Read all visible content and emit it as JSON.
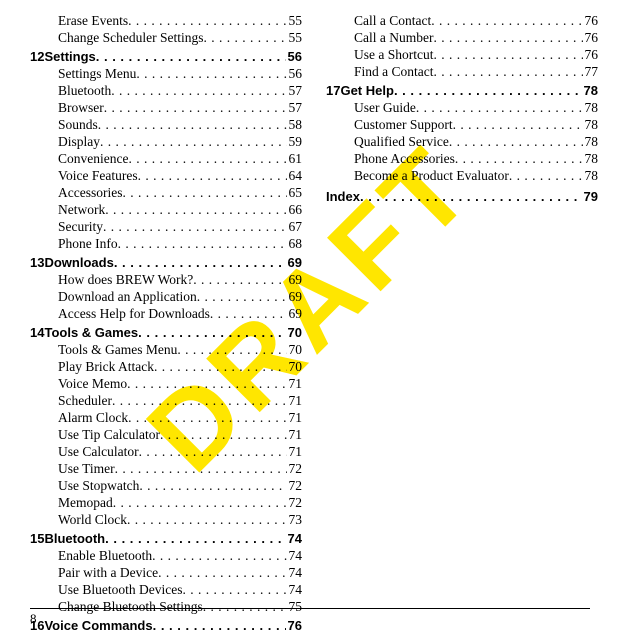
{
  "watermark": "DRAFT",
  "page_number": "8",
  "columns": [
    [
      {
        "type": "sub",
        "title": "Erase Events",
        "page": "55"
      },
      {
        "type": "sub",
        "title": "Change Scheduler Settings",
        "page": "55"
      },
      {
        "type": "chap",
        "num": "12",
        "title": "Settings",
        "page": "56"
      },
      {
        "type": "sub",
        "title": "Settings Menu",
        "page": "56"
      },
      {
        "type": "sub",
        "title": "Bluetooth",
        "page": "57"
      },
      {
        "type": "sub",
        "title": "Browser",
        "page": "57"
      },
      {
        "type": "sub",
        "title": "Sounds",
        "page": "58"
      },
      {
        "type": "sub",
        "title": "Display",
        "page": "59"
      },
      {
        "type": "sub",
        "title": "Convenience",
        "page": "61"
      },
      {
        "type": "sub",
        "title": "Voice Features",
        "page": "64"
      },
      {
        "type": "sub",
        "title": "Accessories",
        "page": "65"
      },
      {
        "type": "sub",
        "title": "Network",
        "page": "66"
      },
      {
        "type": "sub",
        "title": "Security",
        "page": "67"
      },
      {
        "type": "sub",
        "title": "Phone Info",
        "page": "68"
      },
      {
        "type": "chap",
        "num": "13",
        "title": "Downloads",
        "page": "69"
      },
      {
        "type": "sub",
        "title": "How does BREW Work?",
        "page": "69"
      },
      {
        "type": "sub",
        "title": "Download an Application",
        "page": "69"
      },
      {
        "type": "sub",
        "title": "Access Help for Downloads",
        "page": "69"
      },
      {
        "type": "chap",
        "num": "14",
        "title": "Tools & Games",
        "page": "70"
      },
      {
        "type": "sub",
        "title": "Tools & Games Menu",
        "page": "70"
      },
      {
        "type": "sub",
        "title": "Play Brick Attack",
        "page": "70"
      },
      {
        "type": "sub",
        "title": "Voice Memo",
        "page": "71"
      },
      {
        "type": "sub",
        "title": "Scheduler",
        "page": "71"
      },
      {
        "type": "sub",
        "title": "Alarm Clock",
        "page": "71"
      },
      {
        "type": "sub",
        "title": "Use Tip Calculator",
        "page": "71"
      },
      {
        "type": "sub",
        "title": "Use Calculator",
        "page": "71"
      },
      {
        "type": "sub",
        "title": "Use Timer",
        "page": "72"
      },
      {
        "type": "sub",
        "title": "Use Stopwatch",
        "page": "72"
      },
      {
        "type": "sub",
        "title": "Memopad",
        "page": "72"
      },
      {
        "type": "sub",
        "title": "World Clock",
        "page": "73"
      },
      {
        "type": "chap",
        "num": "15",
        "title": "Bluetooth",
        "page": "74"
      },
      {
        "type": "sub",
        "title": "Enable Bluetooth",
        "page": "74"
      },
      {
        "type": "sub",
        "title": "Pair with a Device",
        "page": "74"
      },
      {
        "type": "sub",
        "title": "Use Bluetooth Devices",
        "page": "74"
      },
      {
        "type": "sub",
        "title": "Change Bluetooth Settings",
        "page": "75"
      },
      {
        "type": "chap",
        "num": "16",
        "title": "Voice Commands",
        "page": "76"
      }
    ],
    [
      {
        "type": "sub",
        "title": "Call a Contact",
        "page": "76"
      },
      {
        "type": "sub",
        "title": "Call a Number",
        "page": "76"
      },
      {
        "type": "sub",
        "title": "Use a Shortcut",
        "page": "76"
      },
      {
        "type": "sub",
        "title": "Find a Contact",
        "page": "77"
      },
      {
        "type": "chap",
        "num": "17",
        "title": "Get Help",
        "page": "78"
      },
      {
        "type": "sub",
        "title": "User Guide",
        "page": "78"
      },
      {
        "type": "sub",
        "title": "Customer Support",
        "page": "78"
      },
      {
        "type": "sub",
        "title": "Qualified Service",
        "page": "78"
      },
      {
        "type": "sub",
        "title": "Phone Accessories",
        "page": "78"
      },
      {
        "type": "sub",
        "title": "Become a Product Evaluator",
        "page": "78"
      },
      {
        "type": "index",
        "title": "Index",
        "page": "79"
      }
    ]
  ]
}
